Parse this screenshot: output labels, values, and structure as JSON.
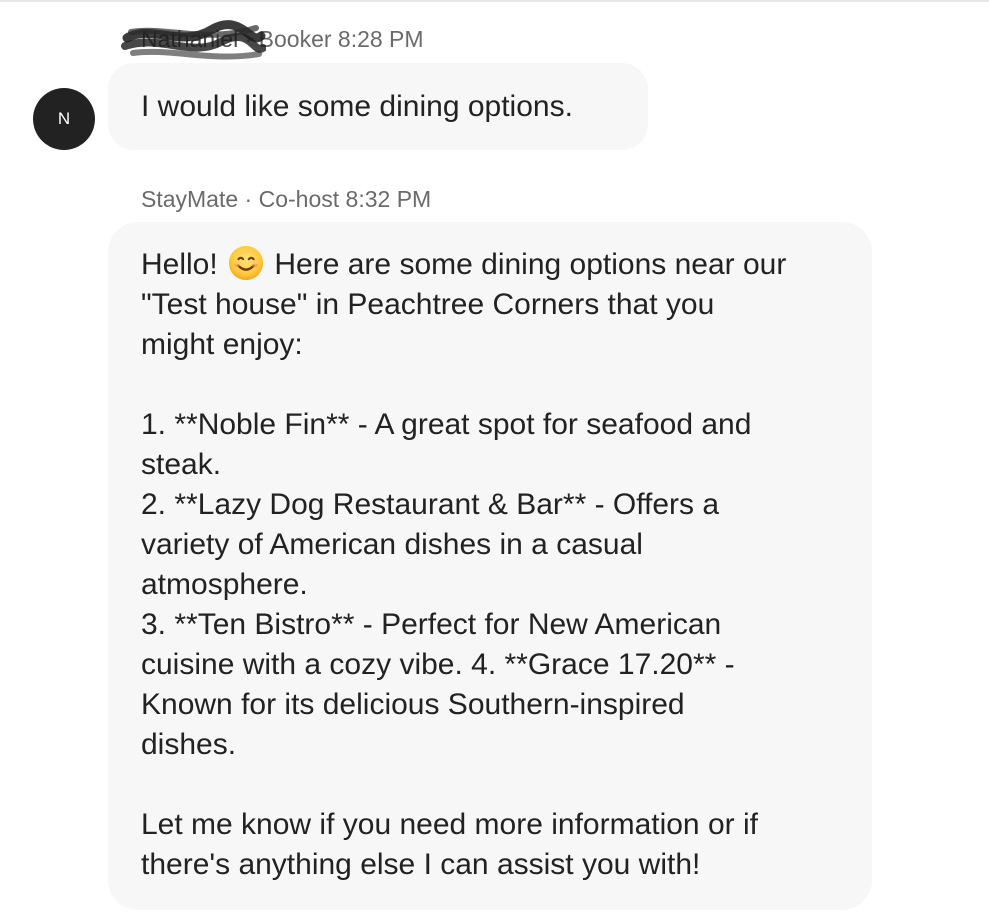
{
  "messages": [
    {
      "sender": "Nathaniel",
      "separator": "·",
      "role": "Booker",
      "time": "8:28 PM",
      "avatar_initial": "N",
      "text": "I would like some dining options."
    },
    {
      "sender": "StayMate",
      "separator": "·",
      "role": "Co-host",
      "time": "8:32 PM",
      "emoji": "smiling-face-icon",
      "lines": {
        "l1_a": "Hello!",
        "l1_b": "Here are some dining options near our",
        "l2": "\"Test house\" in Peachtree Corners that you",
        "l3": "might enjoy:",
        "l4": "1. **Noble Fin** - A great spot for seafood and",
        "l5": "steak.",
        "l6": "2. **Lazy Dog Restaurant & Bar** - Offers a",
        "l7": "variety of American dishes in a casual",
        "l8": "atmosphere.",
        "l9": "3. **Ten Bistro** - Perfect for New American",
        "l10": "cuisine with a cozy vibe. 4. **Grace 17.20** -",
        "l11": "Known for its delicious Southern-inspired",
        "l12": "dishes.",
        "l13": "Let me know if you need more information or if",
        "l14": "there's anything else I can assist you with!"
      }
    }
  ],
  "colors": {
    "bubble_bg": "#f7f7f7",
    "avatar_bg": "#222222",
    "meta_text": "#6a6a6a",
    "body_text": "#222222"
  }
}
